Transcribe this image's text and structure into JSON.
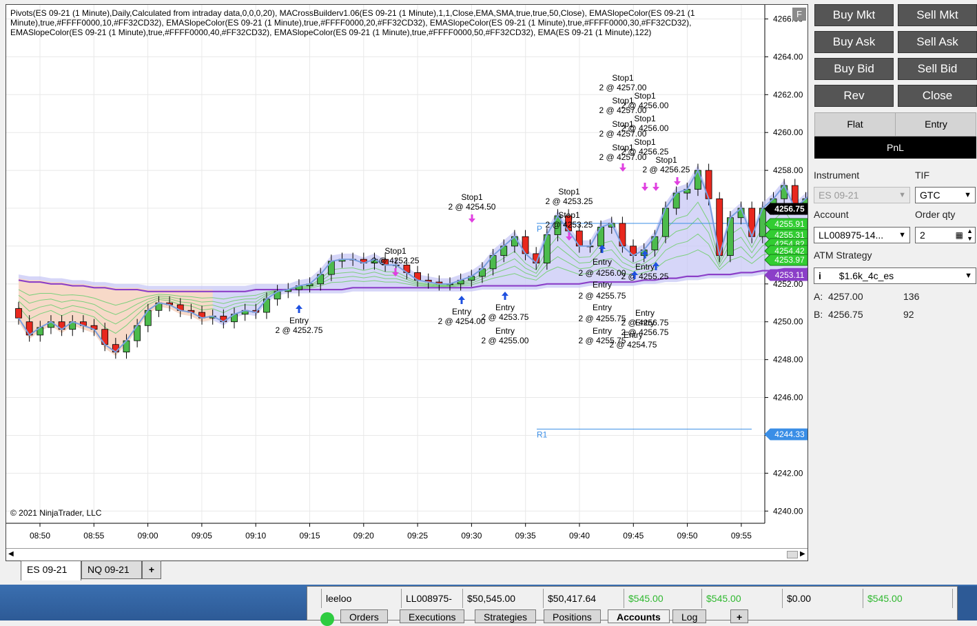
{
  "chart": {
    "indicator_text": "Pivots(ES 09-21 (1 Minute),Daily,Calculated from intraday data,0,0,0,20), MACrossBuilderv1.06(ES 09-21 (1 Minute),1,1,Close,EMA,SMA,true,true,50,Close), EMASlopeColor(ES 09-21 (1 Minute),true,#FFFF0000,10,#FF32CD32), EMASlopeColor(ES 09-21 (1 Minute),true,#FFFF0000,20,#FF32CD32), EMASlopeColor(ES 09-21 (1 Minute),true,#FFFF0000,30,#FF32CD32), EMASlopeColor(ES 09-21 (1 Minute),true,#FFFF0000,40,#FF32CD32), EMASlopeColor(ES 09-21 (1 Minute),true,#FFFF0000,50,#FF32CD32), EMA(ES 09-21 (1 Minute),122)",
    "copyright": "© 2021 NinjaTrader, LLC",
    "f_button": "F",
    "y_ticks": [
      "4266.00",
      "4264.00",
      "4262.00",
      "4260.00",
      "4258.00",
      "4256.00",
      "4254.00",
      "4252.00",
      "4250.00",
      "4248.00",
      "4246.00",
      "4244.00",
      "4242.00",
      "4240.00"
    ],
    "x_ticks": [
      "08:50",
      "08:55",
      "09:00",
      "09:05",
      "09:10",
      "09:15",
      "09:20",
      "09:25",
      "09:30",
      "09:35",
      "09:40",
      "09:45",
      "09:50",
      "09:55"
    ],
    "price_markers": [
      {
        "label": "4256.75",
        "color": "#000000"
      },
      {
        "label": "4255.91",
        "color": "#32cd32"
      },
      {
        "label": "4255.31",
        "color": "#32cd32"
      },
      {
        "label": "4254.82",
        "color": "#32cd32"
      },
      {
        "label": "4254.42",
        "color": "#32cd32"
      },
      {
        "label": "4253.97",
        "color": "#32cd32"
      },
      {
        "label": "4253.11",
        "color": "#8b3fc8"
      },
      {
        "label": "4244.33",
        "color": "#3a8ee6"
      }
    ],
    "pivot_labels": [
      "R1",
      "P"
    ],
    "trade_labels": [
      "Stop1",
      "2 @ 4252.25",
      "Entry",
      "2 @ 4252.75",
      "Stop1",
      "2 @ 4254.50",
      "Entry",
      "2 @ 4254.00",
      "Entry",
      "2 @ 4253.75",
      "Entry",
      "2 @ 4255.00",
      "Stop1",
      "2 @ 4253.25",
      "Stop1",
      "2 @ 4253.25",
      "Entry",
      "2 @ 4256.00",
      "Entry",
      "2 @ 4255.75",
      "Entry",
      "2 @ 4255.75",
      "Entry",
      "2 @ 4255.75",
      "Stop1",
      "2 @ 4257.00",
      "Stop1",
      "2 @ 4256.00",
      "Stop1",
      "2 @ 4257.00",
      "Stop1",
      "2 @ 4256.00",
      "Stop1",
      "2 @ 4257.00",
      "Stop1",
      "2 @ 4256.25",
      "Stop1",
      "2 @ 4257.00",
      "Stop1",
      "2 @ 4256.25",
      "Entry",
      "2 @ 4255.25",
      "Entry",
      "2 @ 4256.75",
      "Entry",
      "2 @ 4256.75",
      "Entry",
      "2 @ 4254.75"
    ],
    "tabs": [
      "ES 09-21",
      "NQ 09-21"
    ],
    "add_tab": "+"
  },
  "chart_data": {
    "type": "candlestick",
    "instrument": "ES 09-21",
    "interval": "1 Minute",
    "ylim": [
      4239.5,
      4266.6
    ],
    "x_start": "08:46",
    "close_prices": [
      4250.2,
      4249.3,
      4249.7,
      4250.0,
      4249.6,
      4250.0,
      4249.8,
      4249.6,
      4248.8,
      4248.4,
      4249.0,
      4249.8,
      4250.6,
      4251.0,
      4250.9,
      4250.6,
      4250.5,
      4250.2,
      4250.3,
      4250.0,
      4250.4,
      4250.6,
      4250.5,
      4251.2,
      4251.6,
      4251.7,
      4251.9,
      4252.0,
      4252.5,
      4253.2,
      4253.3,
      4253.3,
      4253.1,
      4253.3,
      4253.0,
      4253.0,
      4252.6,
      4252.2,
      4252.1,
      4252.0,
      4252.0,
      4252.2,
      4252.4,
      4252.8,
      4253.5,
      4254.0,
      4254.5,
      4253.6,
      4253.1,
      4254.6,
      4255.6,
      4254.8,
      4254.0,
      4254.0,
      4255.0,
      4255.2,
      4254.0,
      4253.5,
      4253.8,
      4254.5,
      4256.0,
      4256.8,
      4257.0,
      4258.0,
      4256.5,
      4253.5,
      4255.5,
      4256.0,
      4254.5,
      4256.0,
      4256.5,
      4257.2,
      4256.0,
      4256.5,
      4257.0,
      4255.0,
      4256.5,
      4256.6,
      4257.0,
      4256.3,
      4256.8
    ],
    "open_prices": [
      4250.7,
      4250.0,
      4249.3,
      4249.7,
      4250.0,
      4249.6,
      4250.0,
      4249.8,
      4249.6,
      4248.8,
      4248.4,
      4249.0,
      4249.8,
      4250.6,
      4251.0,
      4250.9,
      4250.6,
      4250.5,
      4250.2,
      4250.3,
      4250.0,
      4250.4,
      4250.6,
      4250.5,
      4251.2,
      4251.6,
      4251.7,
      4251.9,
      4252.0,
      4252.5,
      4253.2,
      4253.3,
      4253.3,
      4253.1,
      4253.3,
      4253.0,
      4253.0,
      4252.6,
      4252.2,
      4252.1,
      4252.0,
      4252.0,
      4252.2,
      4252.4,
      4252.8,
      4253.5,
      4254.0,
      4254.5,
      4253.6,
      4253.1,
      4254.6,
      4255.6,
      4254.8,
      4254.0,
      4254.0,
      4255.0,
      4255.2,
      4254.0,
      4253.5,
      4253.8,
      4254.5,
      4256.0,
      4256.8,
      4257.0,
      4258.0,
      4256.5,
      4253.5,
      4255.5,
      4256.0,
      4254.5,
      4256.0,
      4256.5,
      4257.2,
      4256.0,
      4256.5,
      4257.0,
      4255.0,
      4256.5,
      4256.6,
      4257.0,
      4256.3
    ],
    "ema_122": [
      4252.2,
      4252.1,
      4252.1,
      4252.0,
      4252.0,
      4251.9,
      4251.9,
      4251.8,
      4251.8,
      4251.7,
      4251.7,
      4251.7,
      4251.6,
      4251.6,
      4251.6,
      4251.6,
      4251.6,
      4251.6,
      4251.6,
      4251.6,
      4251.6,
      4251.6,
      4251.7,
      4251.7,
      4251.7,
      4251.7,
      4251.7,
      4251.7,
      4251.7,
      4251.7,
      4251.7,
      4251.8,
      4251.8,
      4251.8,
      4251.8,
      4251.8,
      4251.8,
      4251.8,
      4251.8,
      4251.8,
      4251.8,
      4251.8,
      4251.8,
      4251.9,
      4251.9,
      4251.9,
      4251.9,
      4251.9,
      4251.9,
      4252.0,
      4252.0,
      4252.0,
      4252.0,
      4252.1,
      4252.1,
      4252.1,
      4252.1,
      4252.1,
      4252.2,
      4252.2,
      4252.3,
      4252.3,
      4252.4,
      4252.4,
      4252.5,
      4252.5,
      4252.5,
      4252.6,
      4252.6,
      4252.7,
      4252.7,
      4252.8,
      4252.8,
      4252.8,
      4252.9,
      4252.9,
      4253.0,
      4253.0,
      4253.0,
      4253.1,
      4253.1
    ],
    "pivot_r1": 4244.33,
    "pivot_p": 4255.2,
    "last_price": 4256.75
  },
  "panel": {
    "buttons": [
      "Buy Mkt",
      "Sell Mkt",
      "Buy Ask",
      "Sell Ask",
      "Buy Bid",
      "Sell Bid",
      "Rev",
      "Close"
    ],
    "flat_label": "Flat",
    "entry_label": "Entry",
    "pnl_label": "PnL",
    "instrument_label": "Instrument",
    "instrument_value": "ES 09-21",
    "tif_label": "TIF",
    "tif_value": "GTC",
    "account_label": "Account",
    "account_value": "LL008975-14...",
    "order_qty_label": "Order qty",
    "order_qty_value": "2",
    "atm_label": "ATM Strategy",
    "atm_value": "$1.6k_4c_es",
    "atm_info": "i",
    "ask_label": "A:",
    "ask_price": "4257.00",
    "ask_size": "136",
    "bid_label": "B:",
    "bid_price": "4256.75",
    "bid_size": "92"
  },
  "accounts": {
    "row": [
      "leeloo",
      "LL008975-",
      "$50,545.00",
      "$50,417.64",
      "$545.00",
      "$545.00",
      "$0.00",
      "$545.00"
    ],
    "tabs": [
      "Orders",
      "Executions",
      "Strategies",
      "Positions",
      "Accounts",
      "Log"
    ],
    "active_tab": "Accounts",
    "add_tab": "+",
    "positive_color": "#2eb82e"
  }
}
